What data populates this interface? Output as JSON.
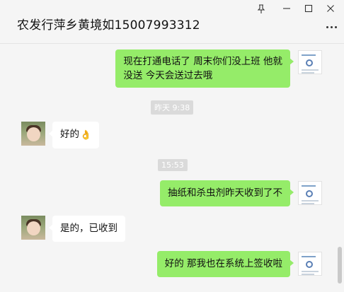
{
  "header": {
    "title": "农发行萍乡黄境如15007993312",
    "icons": [
      "pin-icon",
      "minimize-icon",
      "maximize-icon",
      "close-icon",
      "more-icon"
    ]
  },
  "messages": [
    {
      "side": "out",
      "lines": [
        "现在打通电话了  周末你们没上班 他就",
        "没送  今天会送过去哦"
      ]
    },
    {
      "type": "time",
      "text": "昨天 9:38"
    },
    {
      "side": "in",
      "text": "好的",
      "emoji": "👌"
    },
    {
      "type": "time",
      "text": "15:53"
    },
    {
      "side": "out",
      "text": "抽纸和杀虫剂昨天收到了不"
    },
    {
      "side": "in",
      "text": "是的，已收到"
    },
    {
      "side": "out",
      "text": "好的 那我也在系统上签收啦"
    }
  ],
  "colors": {
    "outgoing_bubble": "#95ec69",
    "incoming_bubble": "#ffffff",
    "background": "#f5f5f5",
    "time_pill": "#dadada"
  }
}
